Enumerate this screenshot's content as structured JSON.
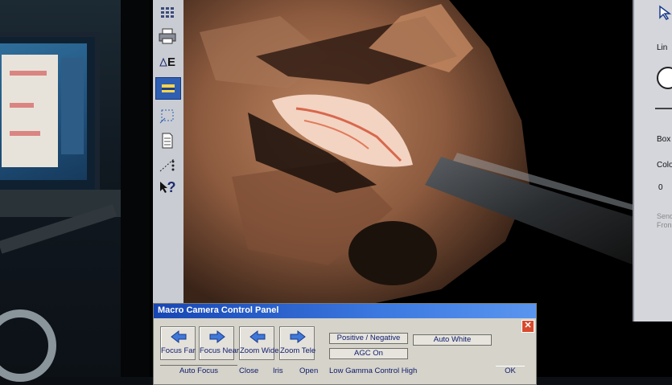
{
  "toolbar": {
    "tools": [
      "grid-icon",
      "printer-icon",
      "text-annotate-icon",
      "color-fill-icon",
      "select-box-icon",
      "document-icon",
      "dotted-line-icon",
      "help-pointer-icon"
    ],
    "text_tool_glyph": "E",
    "help_glyph": "?"
  },
  "right_panel": {
    "line_label": "Lin",
    "box_label": "Box C",
    "color_label": "Colo",
    "value": "0",
    "send_label": "Send",
    "from_label": "Fron"
  },
  "dialog": {
    "title": "Macro Camera Control Panel",
    "close_glyph": "✕",
    "buttons": {
      "focus_far": "Focus Far",
      "focus_near": "Focus Near",
      "zoom_wide": "Zoom Wide",
      "zoom_tele": "Zoom Tele"
    },
    "options": {
      "positive_negative": "Positive / Negative",
      "auto_white": "Auto White",
      "agc": "AGC On"
    },
    "bottom": {
      "auto_focus": "Auto Focus",
      "close": "Close",
      "iris": "Iris",
      "open": "Open",
      "gamma": "Low  Gamma Control  High",
      "ok": "OK"
    }
  },
  "colors": {
    "title_gradient_start": "#1746b3",
    "title_gradient_end": "#5a95ef",
    "button_text": "#0d1a6b",
    "close_button": "#d84a2e"
  }
}
